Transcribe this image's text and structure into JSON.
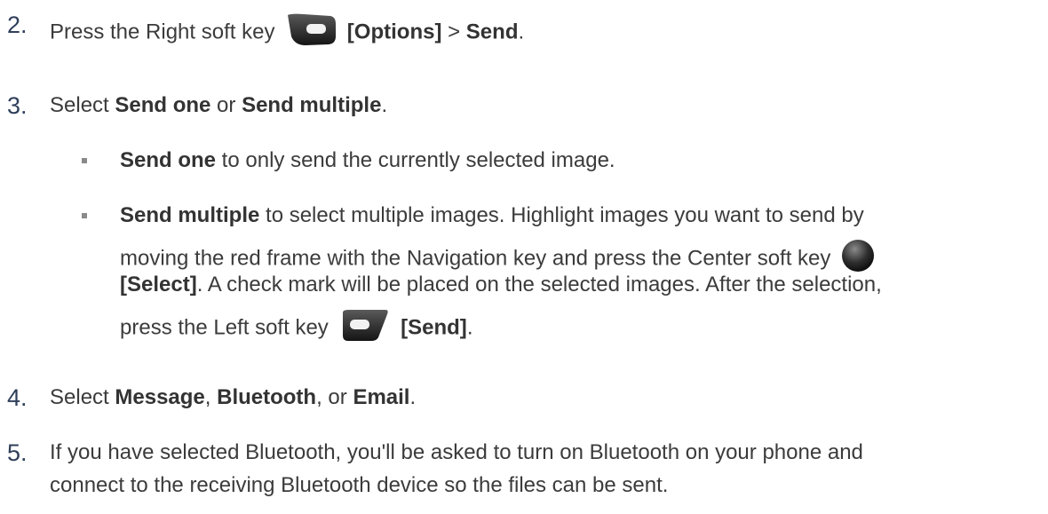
{
  "steps": [
    {
      "number": "2.",
      "prefix": "Press the Right soft key",
      "key_icon": "right-soft-key-icon",
      "options": "[Options]",
      "arrow": " > ",
      "send": "Send",
      "period": "."
    },
    {
      "number": "3.",
      "t1": "Select ",
      "b1": "Send one",
      "t2": " or ",
      "b2": "Send multiple",
      "t3": "."
    },
    {
      "number": "4.",
      "t1": "Select ",
      "b1": "Message",
      "t2": ", ",
      "b2": "Bluetooth",
      "t3": ", or ",
      "b3": "Email",
      "t4": "."
    },
    {
      "number": "5.",
      "line1": "If you have selected Bluetooth, you'll be asked to turn on Bluetooth on your phone and",
      "line2": "connect to the receiving Bluetooth device so the files can be sent."
    }
  ],
  "sub_bullets": [
    {
      "bold": "Send one",
      "text": " to only send the currently selected image."
    },
    {
      "bold": "Send multiple",
      "line1_rest": " to select multiple images. Highlight images you want to send by",
      "line2": "moving the red frame with the Navigation key and press the Center soft key",
      "center_key_icon": "center-soft-key-icon",
      "select_label": "[Select]",
      "line3_rest": ". A check mark will be placed on the selected images. After the selection,",
      "line4": "press the Left soft key",
      "left_key_icon": "left-soft-key-icon",
      "send_label": "[Send]",
      "line4_end": "."
    }
  ],
  "colors": {
    "text": "#3b3b3b",
    "number": "#2f3f5a",
    "key_dark": "#2a2a2a",
    "key_light": "#e8e8e8"
  }
}
